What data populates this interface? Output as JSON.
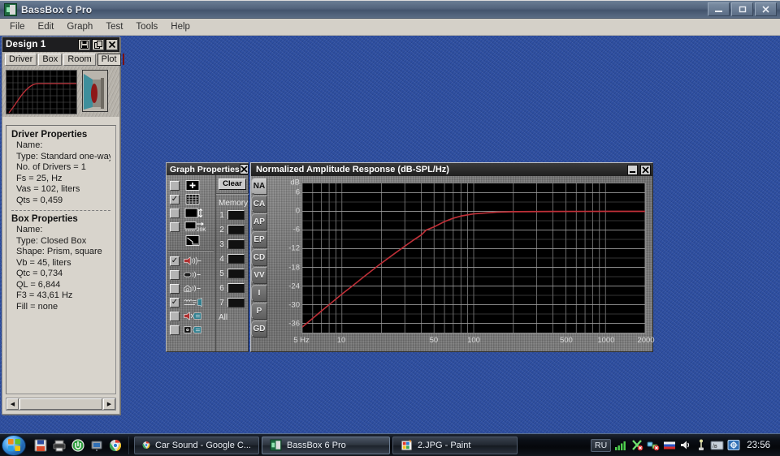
{
  "window": {
    "title": "BassBox 6 Pro",
    "icon": "bassbox-app-icon",
    "controls": {
      "minimize": "–",
      "restore": "❐",
      "close": "✕"
    }
  },
  "menubar": {
    "items": [
      "File",
      "Edit",
      "Graph",
      "Test",
      "Tools",
      "Help"
    ]
  },
  "design_panel": {
    "title": "Design 1",
    "titlebar_buttons": [
      {
        "name": "save-button",
        "glyph": "🖫"
      },
      {
        "name": "copy-button",
        "glyph": "❐"
      },
      {
        "name": "close-button",
        "glyph": "✕"
      }
    ],
    "tabs": [
      {
        "label": "Driver",
        "selected": false
      },
      {
        "label": "Box",
        "selected": false
      },
      {
        "label": "Room",
        "selected": false
      },
      {
        "label": "Plot",
        "selected": true
      }
    ],
    "color_swatch": "#e42020",
    "driver_properties": {
      "heading": "Driver Properties",
      "rows": [
        "Name:",
        "Type: Standard one-way driv",
        "No. of Drivers = 1",
        "Fs =  25, Hz",
        "Vas =  102, liters",
        "Qts =  0,459"
      ]
    },
    "box_properties": {
      "heading": "Box Properties",
      "rows": [
        "Name:",
        "Type: Closed Box",
        "Shape: Prism, square",
        "Vb =  45, liters",
        "Qtc =  0,734",
        "QL =  6,844",
        "F3 =  43,61 Hz",
        "Fill = none"
      ]
    },
    "scrollbar": {
      "left_arrow": "◀",
      "right_arrow": "▶"
    }
  },
  "graph_properties": {
    "title": "Graph Properties",
    "close_label": "✕",
    "clear_label": "Clear",
    "memory_label": "Memory",
    "memory_slots": [
      "1",
      "2",
      "3",
      "4",
      "5",
      "6",
      "7"
    ],
    "memory_all_label": "All",
    "display_options": [
      {
        "name": "show-crosshair-option",
        "icon": "plus-grid-icon",
        "checked": false
      },
      {
        "name": "show-gridlines-option",
        "icon": "grid-icon",
        "checked": true
      },
      {
        "name": "autoscale-vertical-option",
        "icon": "vertical-scale-icon",
        "checked": false
      },
      {
        "name": "frequency-range-20k-option",
        "icon": "frequency-20k-icon",
        "checked": false
      },
      {
        "name": "axis-origin-option",
        "icon": "axis-corner-icon",
        "checked": null
      }
    ],
    "source_options": [
      {
        "name": "driver-response-option",
        "icon": "speaker-waves-icon",
        "checked": true
      },
      {
        "name": "box-response-option",
        "icon": "box-waves-icon",
        "checked": false
      },
      {
        "name": "room-response-option",
        "icon": "house-waves-icon",
        "checked": false
      },
      {
        "name": "filter-response-option",
        "icon": "coil-filter-icon",
        "checked": true
      },
      {
        "name": "speaker-input-option",
        "icon": "speaker-input-icon",
        "checked": false
      },
      {
        "name": "signal-input-option",
        "icon": "signal-input-icon",
        "checked": false
      }
    ]
  },
  "graph_window": {
    "title": "Normalized Amplitude Response (dB-SPL/Hz)",
    "minimize_label": "_",
    "close_label": "✕",
    "tabs": [
      {
        "label": "NA",
        "selected": true
      },
      {
        "label": "CA",
        "selected": false
      },
      {
        "label": "AP",
        "selected": false
      },
      {
        "label": "EP",
        "selected": false
      },
      {
        "label": "CD",
        "selected": false
      },
      {
        "label": "VV",
        "selected": false
      },
      {
        "label": "I",
        "selected": false
      },
      {
        "label": "P",
        "selected": false
      },
      {
        "label": "GD",
        "selected": false
      }
    ]
  },
  "chart_data": {
    "type": "line",
    "title": "Normalized Amplitude Response (dB-SPL/Hz)",
    "xlabel": "",
    "ylabel": "dB",
    "xscale": "log",
    "xlim": [
      5,
      2000
    ],
    "ylim": [
      -39,
      9
    ],
    "grid": true,
    "legend": false,
    "line_color": "#c03038",
    "background": "#000000",
    "gridline_color": "#9c9c9c",
    "ytick_labels": [
      "dB",
      "6",
      "0",
      "-6",
      "-12",
      "-18",
      "-24",
      "-30",
      "-36"
    ],
    "ytick_values": [
      9,
      6,
      0,
      -6,
      -12,
      -18,
      -24,
      -30,
      -36
    ],
    "xtick_labels": [
      "5 Hz",
      "10",
      "50",
      "100",
      "500",
      "1000",
      "2000"
    ],
    "xtick_values": [
      5,
      10,
      50,
      100,
      500,
      1000,
      2000
    ],
    "series": [
      {
        "name": "Normalized amplitude response",
        "x": [
          5,
          6,
          7,
          8,
          9,
          10,
          12,
          15,
          18,
          20,
          25,
          30,
          35,
          40,
          43.6,
          50,
          60,
          70,
          80,
          100,
          150,
          200,
          400,
          700,
          1000,
          2000
        ],
        "values": [
          -37.2,
          -34.4,
          -32.0,
          -30.0,
          -28.2,
          -26.6,
          -24.0,
          -20.7,
          -18.1,
          -16.6,
          -13.6,
          -11.2,
          -9.2,
          -7.6,
          -6.0,
          -5.0,
          -3.3,
          -2.2,
          -1.5,
          -0.8,
          -0.25,
          -0.1,
          -0.03,
          -0.01,
          0.0,
          0.0
        ]
      }
    ]
  },
  "taskbar": {
    "start_label": "start-orb",
    "quick_launch": [
      {
        "name": "save-icon"
      },
      {
        "name": "printer-icon"
      },
      {
        "name": "utorrent-icon"
      },
      {
        "name": "media-icon"
      },
      {
        "name": "chrome-icon"
      }
    ],
    "tasks": [
      {
        "label": "Car Sound - Google C...",
        "icon": "chrome-icon",
        "active": false
      },
      {
        "label": "BassBox 6 Pro",
        "icon": "bassbox-app-icon",
        "active": true
      },
      {
        "label": "2.JPG - Paint",
        "icon": "paint-icon",
        "active": false
      }
    ],
    "tray": {
      "language": "RU",
      "icons": [
        "network-signal-icon",
        "antivirus-icon",
        "network-error-icon",
        "flag-ru-icon",
        "volume-icon",
        "usb-icon",
        "keyboard-layout-icon",
        "app-tray-icon"
      ],
      "clock": "23:56"
    }
  },
  "colors": {
    "desktop": "#2c4da0",
    "accent_red": "#c03038",
    "titlebar": "#52637c"
  }
}
